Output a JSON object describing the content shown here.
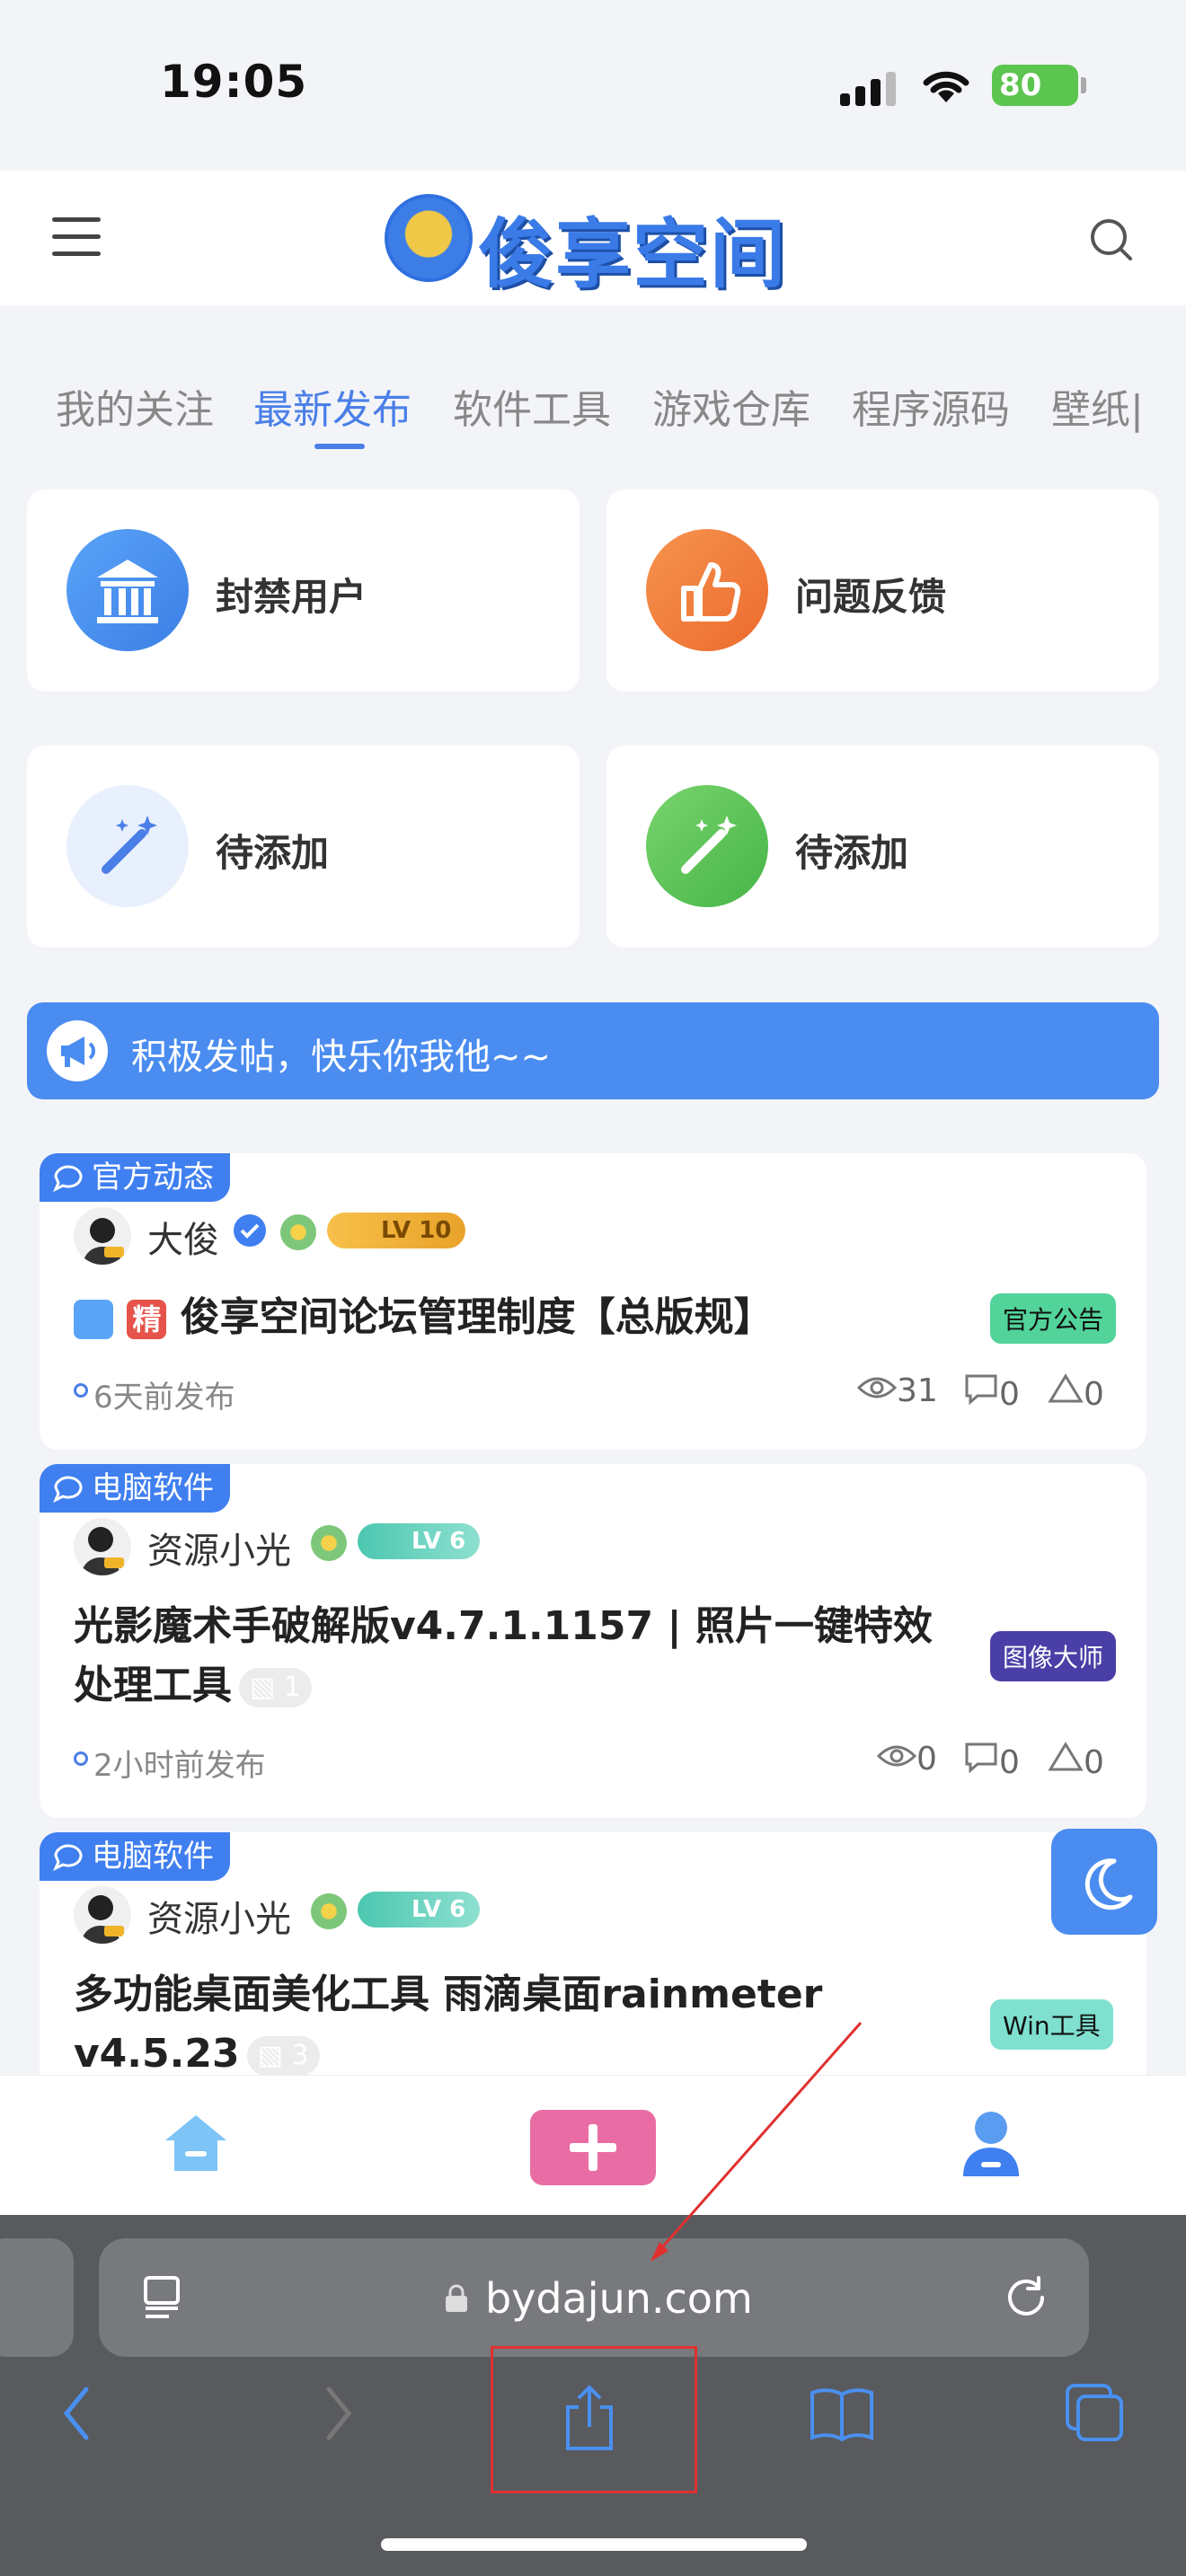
{
  "status_bar": {
    "time": "19:05",
    "battery": "80"
  },
  "header": {
    "logo_text": "俊享空间"
  },
  "tabs": [
    {
      "label": "我的关注",
      "active": false
    },
    {
      "label": "最新发布",
      "active": true
    },
    {
      "label": "软件工具",
      "active": false
    },
    {
      "label": "游戏仓库",
      "active": false
    },
    {
      "label": "程序源码",
      "active": false
    },
    {
      "label": "壁纸|",
      "active": false
    }
  ],
  "feature_cards": [
    {
      "label": "封禁用户",
      "icon": "bank-icon",
      "color": "#4a8cf0"
    },
    {
      "label": "问题反馈",
      "icon": "thumbs-up-icon",
      "color": "#f07a3a"
    },
    {
      "label": "待添加",
      "icon": "magic-wand-icon",
      "color": "#e8f0fd"
    },
    {
      "label": "待添加",
      "icon": "magic-wand-icon",
      "color": "#5cc75a"
    }
  ],
  "notice": {
    "text": "积极发帖，快乐你我他~~"
  },
  "posts": [
    {
      "category": "官方动态",
      "author": "大俊",
      "level": "LV 10",
      "sticky_badge": "精",
      "title": "俊享空间论坛管理制度【总版规】",
      "tag": "官方公告",
      "time": "6天前发布",
      "views": "31",
      "comments": "0",
      "likes": "0"
    },
    {
      "category": "电脑软件",
      "author": "资源小光",
      "level": "LV 6",
      "title_line1": "光影魔术手破解版v4.7.1.1157 | 照片一键特效",
      "title_line2": "处理工具",
      "image_count": "1",
      "tag": "图像大师",
      "time": "2小时前发布",
      "views": "0",
      "comments": "0",
      "likes": "0"
    },
    {
      "category": "电脑软件",
      "author": "资源小光",
      "level": "LV 6",
      "title_line1": "多功能桌面美化工具 雨滴桌面rainmeter",
      "title_line2": "v4.5.23",
      "image_count": "3",
      "tag": "Win工具"
    }
  ],
  "browser": {
    "url": "bydajun.com"
  },
  "colors": {
    "accent": "#4a7fe8",
    "notice_bg": "#4a8cf0",
    "add_button": "#e96da4",
    "annotation": "#e03030"
  }
}
